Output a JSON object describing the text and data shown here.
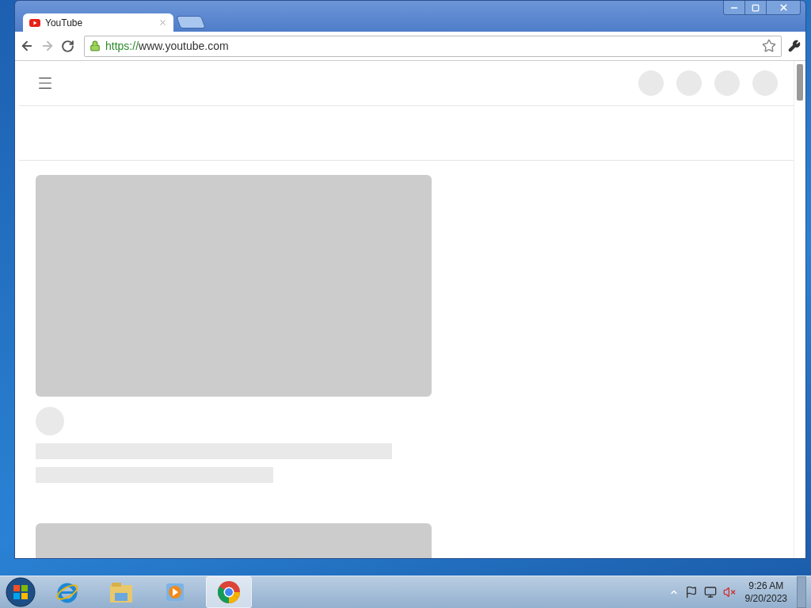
{
  "window": {
    "tabs": [
      {
        "title": "YouTube",
        "selected": true
      }
    ]
  },
  "toolbar": {
    "back_enabled": true,
    "forward_enabled": false,
    "url_scheme": "https://",
    "url_host": "www.youtube.com",
    "bookmarked": false
  },
  "taskbar": {
    "apps": [
      {
        "kind": "ie",
        "selected": false
      },
      {
        "kind": "explorer",
        "selected": false
      },
      {
        "kind": "media",
        "selected": false
      },
      {
        "kind": "chrome",
        "selected": true
      }
    ],
    "tray": {
      "time": "9:26 AM",
      "date": "9/20/2023"
    }
  }
}
